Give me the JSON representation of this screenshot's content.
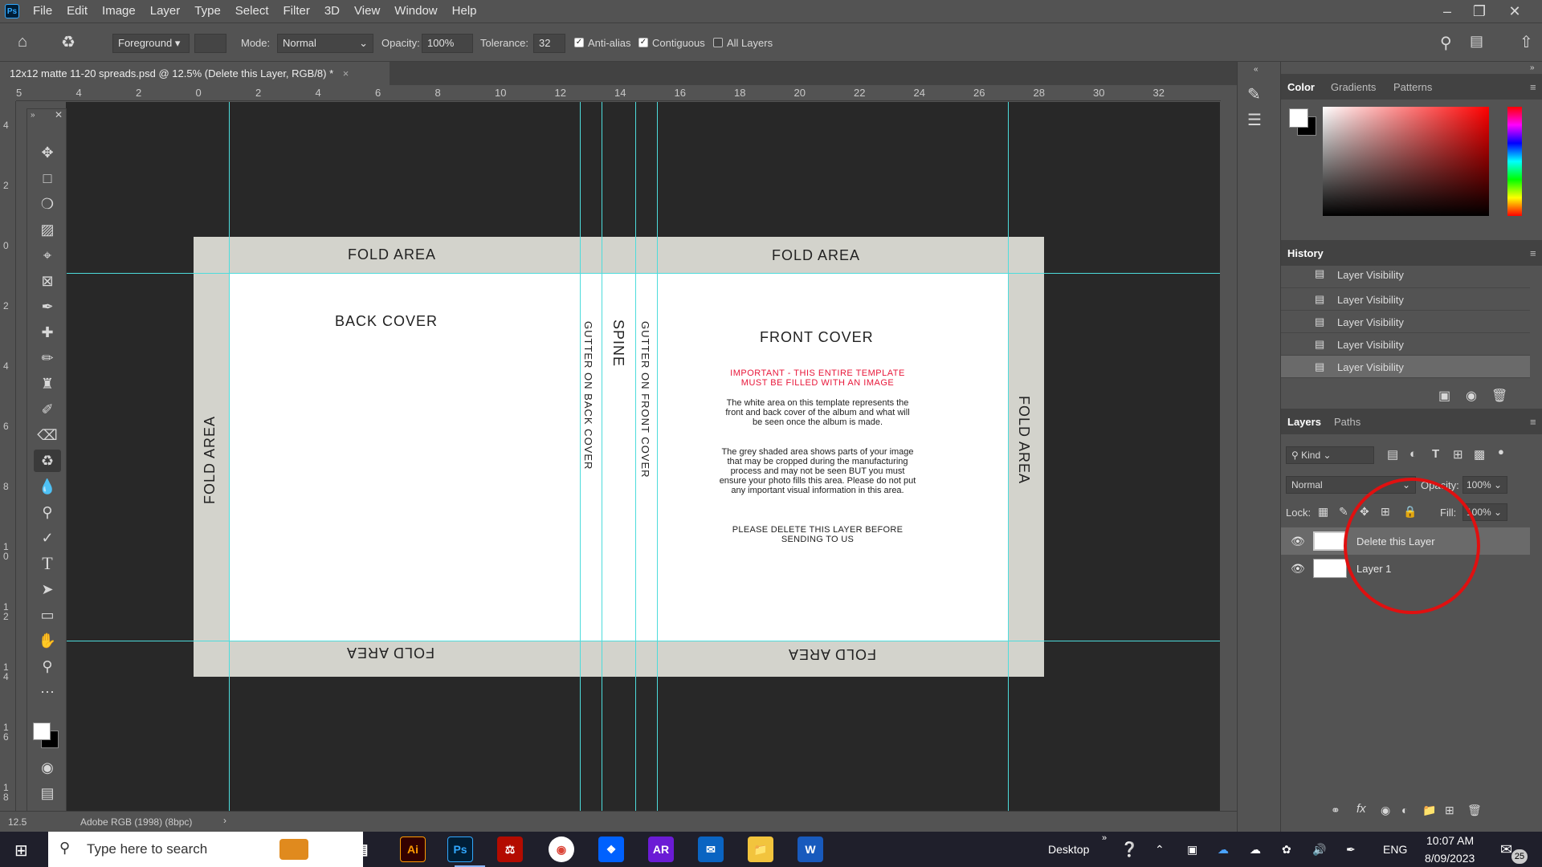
{
  "app": {
    "logo": "Ps"
  },
  "menu": [
    "File",
    "Edit",
    "Image",
    "Layer",
    "Type",
    "Select",
    "Filter",
    "3D",
    "View",
    "Window",
    "Help"
  ],
  "options": {
    "fill_source": "Foreground",
    "mode_label": "Mode:",
    "mode_value": "Normal",
    "opacity_label": "Opacity:",
    "opacity_value": "100%",
    "tolerance_label": "Tolerance:",
    "tolerance_value": "32",
    "antialias_label": "Anti-alias",
    "contiguous_label": "Contiguous",
    "all_layers_label": "All Layers"
  },
  "document_tab": {
    "title": "12x12 matte 11-20 spreads.psd @ 12.5% (Delete this Layer, RGB/8) *",
    "close": "×"
  },
  "ruler_top": [
    "5",
    "4",
    "2",
    "0",
    "2",
    "4",
    "6",
    "8",
    "10",
    "12",
    "14",
    "16",
    "18",
    "20",
    "22",
    "24",
    "26",
    "28",
    "30",
    "32"
  ],
  "ruler_left": [
    "4",
    "2",
    "0",
    "2",
    "4",
    "6",
    "8",
    "1 0",
    "1 2",
    "1 4",
    "1 6",
    "1 8"
  ],
  "template": {
    "fold_top_left": "FOLD AREA",
    "fold_top_right": "FOLD AREA",
    "fold_bottom_left": "FOLD AREA",
    "fold_bottom_right": "FOLD AREA",
    "fold_left": "FOLD AREA",
    "fold_right": "FOLD AREA",
    "back_cover": "BACK COVER",
    "front_cover": "FRONT COVER",
    "gutter_back": "GUTTER ON BACK COVER",
    "spine": "SPINE",
    "gutter_front": "GUTTER ON FRONT COVER",
    "important": "IMPORTANT - THIS ENTIRE TEMPLATE MUST BE FILLED WITH AN IMAGE",
    "para1": "The white area on this template represents the front and back cover of the album and what will be seen once the album is made.",
    "para2": "The grey shaded area shows parts of your image that may be cropped during the manufacturing process and may not be seen BUT you must ensure your photo fills this area.  Please do not put any important visual information in this area.",
    "para3": "PLEASE DELETE THIS LAYER BEFORE SENDING TO US",
    "important_color": "#e8173a"
  },
  "status": {
    "zoom": "12.5",
    "profile": "Adobe RGB (1998) (8bpc)"
  },
  "panels": {
    "color_tabs": [
      "Color",
      "Gradients",
      "Patterns"
    ],
    "history_title": "History",
    "history_items": [
      "Layer Visibility",
      "Layer Visibility",
      "Layer Visibility",
      "Layer Visibility",
      "Layer Visibility"
    ],
    "layers_tabs": [
      "Layers",
      "Paths"
    ],
    "kind_label": "Kind",
    "blend_mode": "Normal",
    "opacity_label": "Opacity:",
    "opacity_value": "100%",
    "lock_label": "Lock:",
    "fill_label": "Fill:",
    "fill_value": "100%",
    "layers": [
      "Delete this Layer",
      "Layer 1"
    ]
  },
  "taskbar": {
    "search_placeholder": "Type here to search",
    "desktop_label": "Desktop",
    "lang": "ENG",
    "time": "10:07 AM",
    "date": "8/09/2023",
    "notif_count": "25",
    "apps": [
      "Ai",
      "Ps",
      "AR"
    ]
  },
  "colors": {
    "accent_guide": "#4ddcdc",
    "annotation_circle": "#e01010"
  }
}
